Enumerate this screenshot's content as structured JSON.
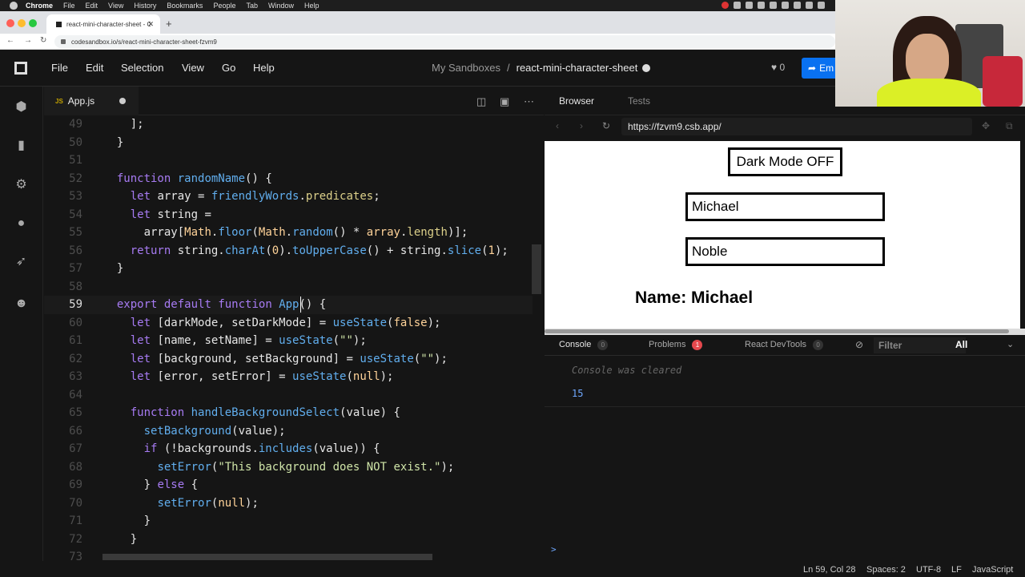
{
  "macos": {
    "menus": [
      "Chrome",
      "File",
      "Edit",
      "View",
      "History",
      "Bookmarks",
      "People",
      "Tab",
      "Window",
      "Help"
    ]
  },
  "browser": {
    "tab_title": "react-mini-character-sheet - C",
    "url": "codesandbox.io/s/react-mini-character-sheet-fzvm9"
  },
  "header": {
    "menus": [
      "File",
      "Edit",
      "Selection",
      "View",
      "Go",
      "Help"
    ],
    "breadcrumb_root": "My Sandboxes",
    "breadcrumb_sep": "/",
    "project": "react-mini-character-sheet",
    "likes": "0",
    "embed_label": "Em"
  },
  "editor": {
    "file_tab": "App.js",
    "file_badge": "JS",
    "active_line": "59"
  },
  "code_lines": [
    {
      "n": "49",
      "html": "    ];"
    },
    {
      "n": "50",
      "html": "  }"
    },
    {
      "n": "51",
      "html": ""
    },
    {
      "n": "52",
      "html": "  <span class='kw'>function</span> <span class='fn'>randomName</span>() {"
    },
    {
      "n": "53",
      "html": "    <span class='kw'>let</span> array = <span class='fn'>friendlyWords</span>.<span class='pr'>predicates</span>;"
    },
    {
      "n": "54",
      "html": "    <span class='kw'>let</span> string ="
    },
    {
      "n": "55",
      "html": "      array[<span class='nb'>Math</span>.<span class='fn'>floor</span>(<span class='nb'>Math</span>.<span class='fn'>random</span>() * <span class='nb'>array</span>.<span class='pr'>length</span>)];"
    },
    {
      "n": "56",
      "html": "    <span class='kw'>return</span> string.<span class='fn'>charAt</span>(<span class='nb'>0</span>).<span class='fn'>toUpperCase</span>() + string.<span class='fn'>slice</span>(<span class='nb'>1</span>);"
    },
    {
      "n": "57",
      "html": "  }"
    },
    {
      "n": "58",
      "html": ""
    },
    {
      "n": "59",
      "html": "  <span class='kw'>export</span> <span class='kw'>default</span> <span class='kw'>function</span> <span class='fn'>App</span>() {"
    },
    {
      "n": "60",
      "html": "    <span class='kw'>let</span> [darkMode, setDarkMode] = <span class='fn'>useState</span>(<span class='nb'>false</span>);"
    },
    {
      "n": "61",
      "html": "    <span class='kw'>let</span> [name, setName] = <span class='fn'>useState</span>(<span class='st'>\"\"</span>);"
    },
    {
      "n": "62",
      "html": "    <span class='kw'>let</span> [background, setBackground] = <span class='fn'>useState</span>(<span class='st'>\"\"</span>);"
    },
    {
      "n": "63",
      "html": "    <span class='kw'>let</span> [error, setError] = <span class='fn'>useState</span>(<span class='nb'>null</span>);"
    },
    {
      "n": "64",
      "html": ""
    },
    {
      "n": "65",
      "html": "    <span class='kw'>function</span> <span class='fn'>handleBackgroundSelect</span>(value) {"
    },
    {
      "n": "66",
      "html": "      <span class='fn'>setBackground</span>(value);"
    },
    {
      "n": "67",
      "html": "      <span class='kw'>if</span> (!backgrounds.<span class='fn'>includes</span>(value)) {"
    },
    {
      "n": "68",
      "html": "        <span class='fn'>setError</span>(<span class='st'>\"This background does NOT exist.\"</span>);"
    },
    {
      "n": "69",
      "html": "      } <span class='kw'>else</span> {"
    },
    {
      "n": "70",
      "html": "        <span class='fn'>setError</span>(<span class='nb'>null</span>);"
    },
    {
      "n": "71",
      "html": "      }"
    },
    {
      "n": "72",
      "html": "    }"
    },
    {
      "n": "73",
      "html": ""
    }
  ],
  "preview": {
    "tab_browser": "Browser",
    "tab_tests": "Tests",
    "url": "https://fzvm9.csb.app/",
    "dark_mode_button": "Dark Mode OFF",
    "name_input_value": "Michael",
    "background_input_value": "Noble",
    "name_heading": "Name: Michael"
  },
  "console": {
    "tabs": [
      {
        "label": "Console",
        "count": "0"
      },
      {
        "label": "Problems",
        "count": "1"
      },
      {
        "label": "React DevTools",
        "count": "0"
      }
    ],
    "filter_placeholder": "Filter",
    "level": "All",
    "cleared_message": "Console was cleared",
    "log_value": "15",
    "prompt": ">"
  },
  "statusbar": {
    "position": "Ln 59, Col 28",
    "spaces": "Spaces: 2",
    "encoding": "UTF-8",
    "eol": "LF",
    "language": "JavaScript"
  },
  "colors": {
    "accent": "#0971f1",
    "error_badge": "#e5484d",
    "keyword": "#a77bf3",
    "function": "#61aeee"
  }
}
